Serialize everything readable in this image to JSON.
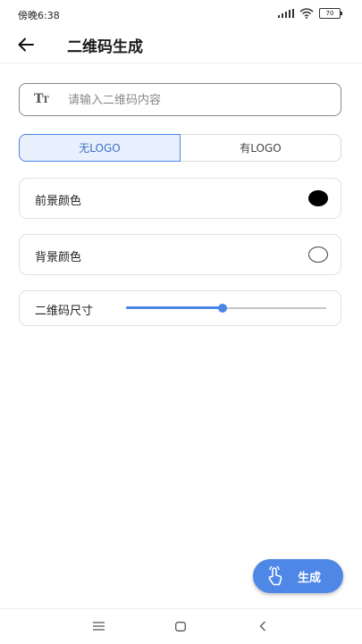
{
  "status_bar": {
    "time": "傍晚6:38",
    "battery": "70"
  },
  "header": {
    "title": "二维码生成"
  },
  "input": {
    "placeholder": "请输入二维码内容",
    "value": ""
  },
  "logo_toggle": {
    "options": [
      "无LOGO",
      "有LOGO"
    ],
    "selected": "无LOGO"
  },
  "foreground": {
    "label": "前景颜色",
    "color": "#000000"
  },
  "background": {
    "label": "背景颜色",
    "color": "#ffffff"
  },
  "size": {
    "label": "二维码尺寸",
    "value_fraction": 0.48
  },
  "fab": {
    "label": "生成",
    "icon": "touch-icon"
  },
  "colors": {
    "accent": "#4a86e8",
    "accent_light": "#e8f0fd"
  },
  "icons": {
    "back": "back-arrow-icon",
    "text": "text-size-icon",
    "menu": "menu-icon",
    "home": "home-icon",
    "back_nav": "back-nav-icon"
  }
}
